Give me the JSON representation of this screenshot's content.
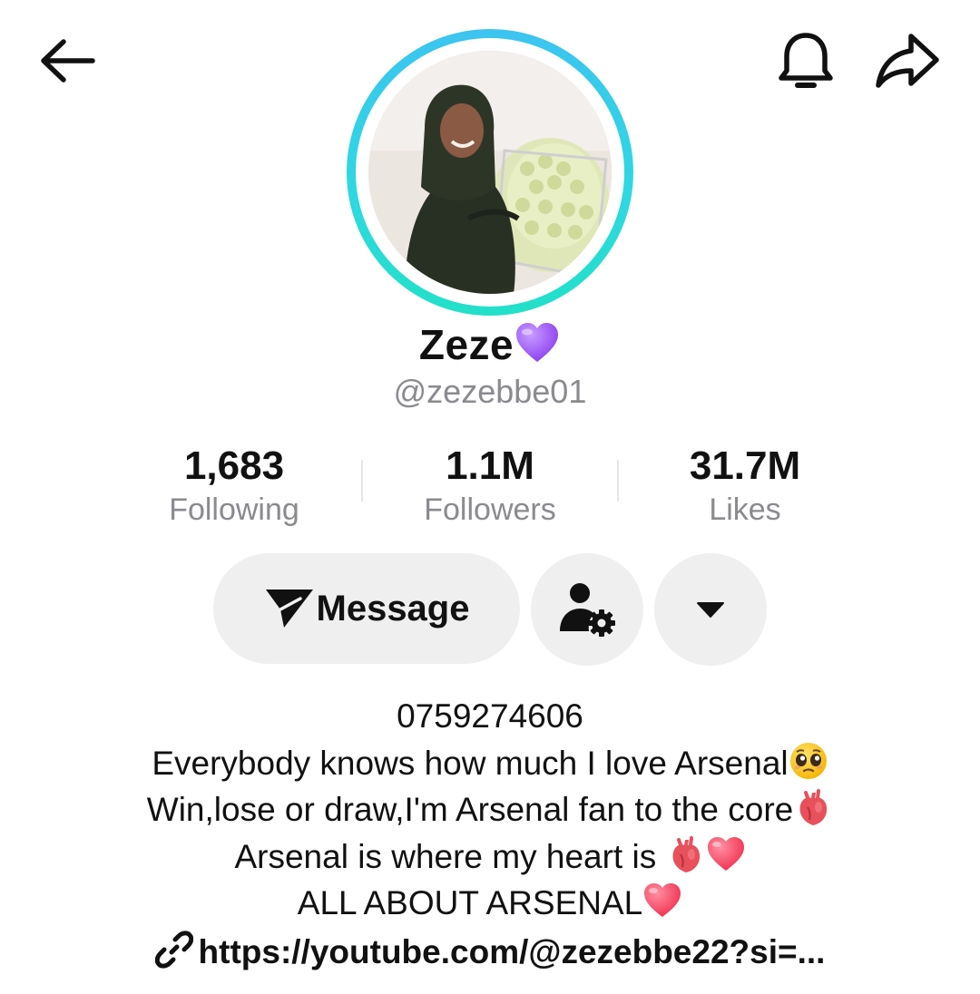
{
  "header": {
    "back_icon": "back-arrow-icon",
    "bell_icon": "bell-icon",
    "share_icon": "share-arrow-icon"
  },
  "profile": {
    "display_name": "Zeze",
    "name_emoji": "purple-heart",
    "handle": "@zezebbe01",
    "avatar_ring_color": "#2fd7e2"
  },
  "stats": [
    {
      "value": "1,683",
      "label": "Following"
    },
    {
      "value": "1.1M",
      "label": "Followers"
    },
    {
      "value": "31.7M",
      "label": "Likes"
    }
  ],
  "actions": {
    "message_label": "Message",
    "message_icon": "send-plane-icon",
    "settings_icon": "user-gear-icon",
    "more_icon": "caret-down-icon",
    "button_bg": "#efefef"
  },
  "bio": {
    "phone": "0759274606",
    "line1": "Everybody knows how much I love Arsenal",
    "line1_emoji": "pleading-face",
    "line2": "Win,lose or draw,I'm Arsenal fan to the core",
    "line2_emoji": "anatomical-heart",
    "line3": "Arsenal is where my heart is ",
    "line3_emojis": [
      "anatomical-heart",
      "red-heart"
    ],
    "line4": "ALL ABOUT ARSENAL",
    "line4_emoji": "red-heart"
  },
  "link": {
    "icon": "link-icon",
    "text": "https://youtube.com/@zezebbe22?si=..."
  }
}
